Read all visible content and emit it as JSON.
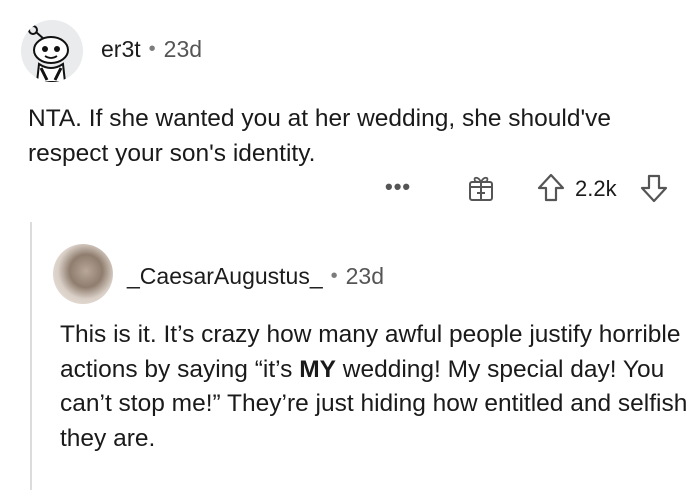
{
  "parent_comment": {
    "username": "er3t",
    "separator": "•",
    "time": "23d",
    "text": "NTA. If she wanted you at her wedding, she should've respect your son's identity.",
    "actions": {
      "more_label": "•••",
      "score": "2.2k",
      "award_icon": "gift-award-icon",
      "upvote_icon": "arrow-up-icon",
      "downvote_icon": "arrow-down-icon"
    }
  },
  "reply_comment": {
    "username": "_CaesarAugustus_",
    "separator": "•",
    "time": "23d",
    "text_before_emphasis": "This is it. It’s crazy how many awful people justify horrible actions by saying “it’s ",
    "text_emphasis": "MY",
    "text_after_emphasis": " wedding! My special day! You can’t stop me!” They’re just hiding how entitled and selfish they are."
  },
  "colors": {
    "text": "#1a1a1b",
    "meta": "#555555",
    "thread_line": "#dcdcdc"
  }
}
